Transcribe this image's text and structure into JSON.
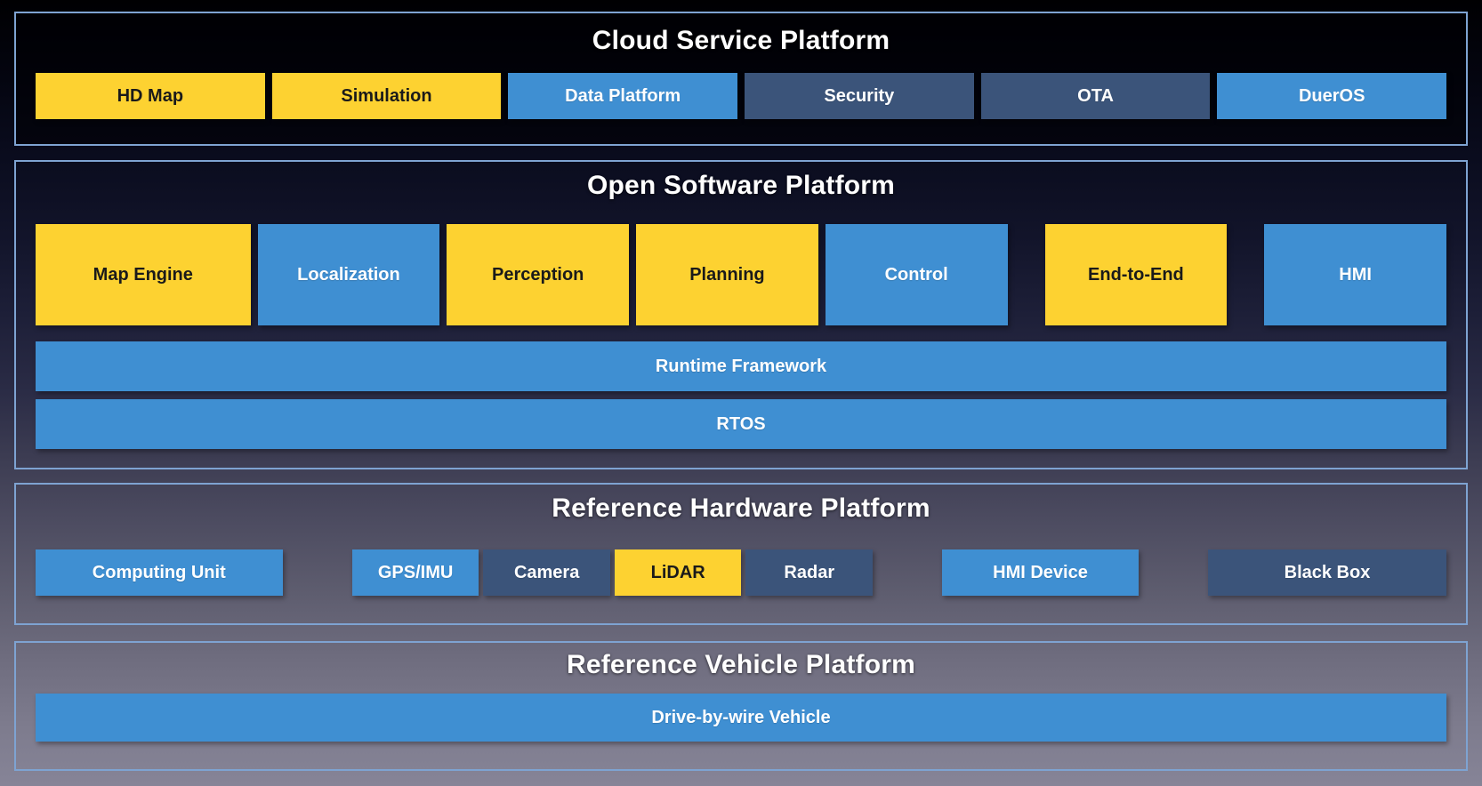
{
  "colors": {
    "yellow": "#FDD231",
    "blue": "#3F8FD2",
    "slate": "#3B547A",
    "border": "#7EA3D2",
    "yellow_text": "#1A1A1A",
    "light_text": "#FFFFFF",
    "background_top": "#000002",
    "background_bottom": "#868497"
  },
  "sections": [
    {
      "id": "cloud",
      "title": "Cloud Service Platform",
      "boxes": [
        {
          "label": "HD Map",
          "color": "yellow"
        },
        {
          "label": "Simulation",
          "color": "yellow"
        },
        {
          "label": "Data Platform",
          "color": "blue"
        },
        {
          "label": "Security",
          "color": "slate"
        },
        {
          "label": "OTA",
          "color": "slate"
        },
        {
          "label": "DuerOS",
          "color": "blue"
        }
      ]
    },
    {
      "id": "software",
      "title": "Open Software Platform",
      "boxes": [
        {
          "label": "Map Engine",
          "color": "yellow"
        },
        {
          "label": "Localization",
          "color": "blue"
        },
        {
          "label": "Perception",
          "color": "yellow"
        },
        {
          "label": "Planning",
          "color": "yellow"
        },
        {
          "label": "Control",
          "color": "blue"
        },
        {
          "label": "End-to-End",
          "color": "yellow"
        },
        {
          "label": "HMI",
          "color": "blue"
        }
      ],
      "bars": [
        {
          "label": "Runtime Framework",
          "color": "blue"
        },
        {
          "label": "RTOS",
          "color": "blue"
        }
      ]
    },
    {
      "id": "hardware",
      "title": "Reference Hardware Platform",
      "boxes": [
        {
          "label": "Computing Unit",
          "color": "blue"
        },
        {
          "label": "GPS/IMU",
          "color": "blue"
        },
        {
          "label": "Camera",
          "color": "slate"
        },
        {
          "label": "LiDAR",
          "color": "yellow"
        },
        {
          "label": "Radar",
          "color": "slate"
        },
        {
          "label": "HMI Device",
          "color": "blue"
        },
        {
          "label": "Black Box",
          "color": "slate"
        }
      ]
    },
    {
      "id": "vehicle",
      "title": "Reference Vehicle Platform",
      "bars": [
        {
          "label": "Drive-by-wire Vehicle",
          "color": "blue"
        }
      ]
    }
  ]
}
